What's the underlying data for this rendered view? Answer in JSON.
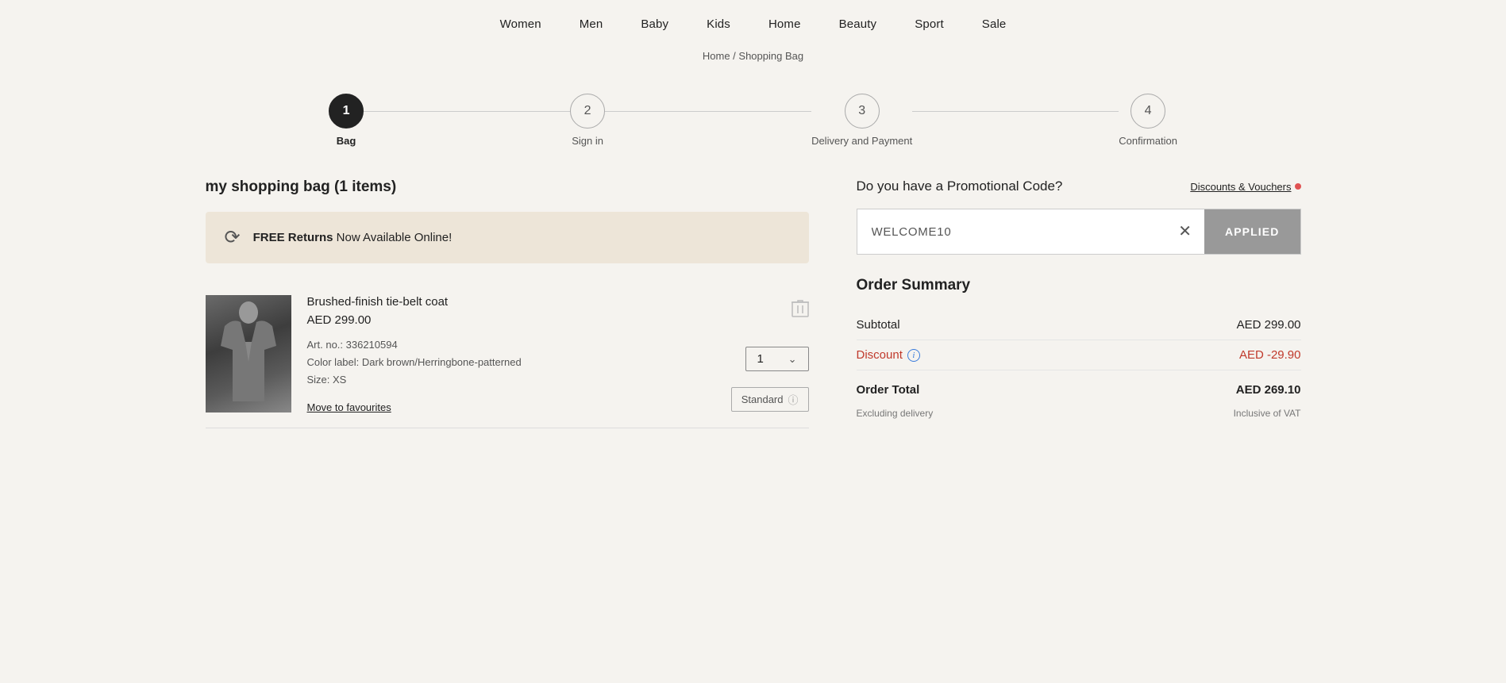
{
  "nav": {
    "items": [
      "Women",
      "Men",
      "Baby",
      "Kids",
      "Home",
      "Beauty",
      "Sport",
      "Sale"
    ]
  },
  "breadcrumb": {
    "text": "Home / Shopping Bag",
    "home": "Home",
    "separator": "/",
    "current": "Shopping Bag"
  },
  "stepper": {
    "steps": [
      {
        "number": "1",
        "label": "Bag",
        "active": true
      },
      {
        "number": "2",
        "label": "Sign in",
        "active": false
      },
      {
        "number": "3",
        "label": "Delivery and Payment",
        "active": false
      },
      {
        "number": "4",
        "label": "Confirmation",
        "active": false
      }
    ]
  },
  "bag": {
    "title": "my shopping bag (1 items)",
    "free_returns_bold": "FREE Returns",
    "free_returns_rest": " Now Available Online!",
    "items": [
      {
        "name": "Brushed-finish tie-belt coat",
        "price": "AED  299.00",
        "art_no": "Art. no.: 336210594",
        "color_label": "Color label: Dark brown/Herringbone-patterned",
        "size": "Size: XS",
        "qty": "1",
        "move_to_fav": "Move to favourites",
        "shipping_label": "Standard",
        "shipping_info": "ⓘ"
      }
    ]
  },
  "promo": {
    "question": "Do you have a Promotional Code?",
    "discounts_link": "Discounts & Vouchers",
    "code_value": "WELCOME10",
    "applied_label": "APPLIED"
  },
  "order_summary": {
    "title": "Order Summary",
    "subtotal_label": "Subtotal",
    "subtotal_value": "AED 299.00",
    "discount_label": "Discount",
    "discount_value": "AED -29.90",
    "total_label": "Order Total",
    "total_value": "AED 269.10",
    "excl_delivery": "Excluding delivery",
    "incl_vat": "Inclusive of VAT"
  }
}
